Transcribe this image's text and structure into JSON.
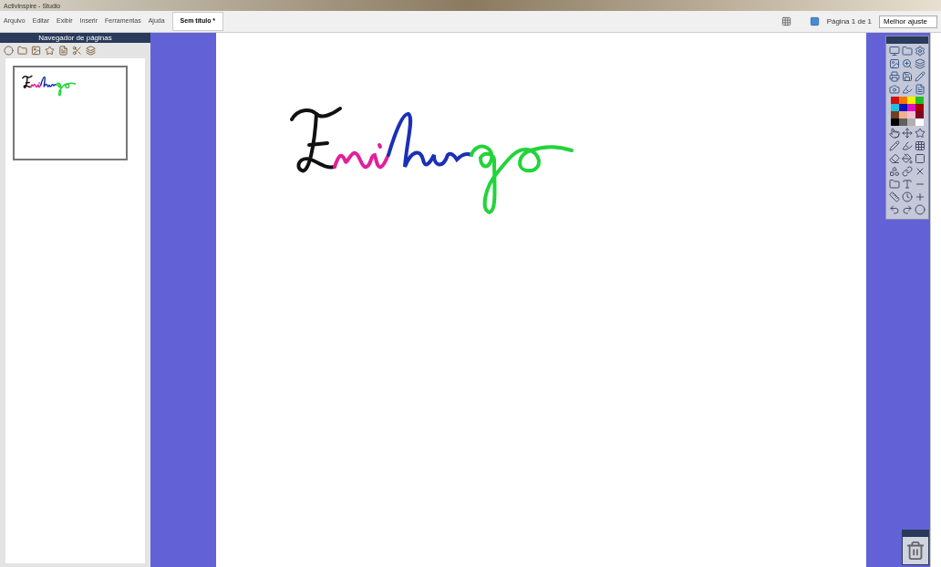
{
  "window": {
    "title": "ActivInspire - Studio"
  },
  "menu": [
    "Arquivo",
    "Editar",
    "Exibir",
    "Inserir",
    "Ferramentas",
    "Ajuda"
  ],
  "document_tab": {
    "label": "Sem título *",
    "selected": true
  },
  "page_indicator": "Página 1 de 1",
  "zoom_select": {
    "value": "Melhor ajuste"
  },
  "navigator": {
    "title": "Navegador de páginas"
  },
  "ink": [
    {
      "color": "#111111"
    },
    {
      "color": "#e0219a"
    },
    {
      "color": "#1b2fb8"
    },
    {
      "color": "#22d43a"
    }
  ],
  "palette": [
    {
      "color": "#d01010"
    },
    {
      "color": "#f07800"
    },
    {
      "color": "#f0f000"
    },
    {
      "color": "#20c020"
    },
    {
      "color": "#20c0e0"
    },
    {
      "color": "#1010c0"
    },
    {
      "color": "#e010c0"
    },
    {
      "color": "#a00000"
    },
    {
      "color": "#704020"
    },
    {
      "color": "#f0b090"
    },
    {
      "color": "#f0c0d0"
    },
    {
      "color": "#800020"
    },
    {
      "color": "#000000"
    },
    {
      "color": "#606060"
    },
    {
      "color": "#b0b0b0"
    },
    {
      "color": "#ffffff"
    }
  ]
}
